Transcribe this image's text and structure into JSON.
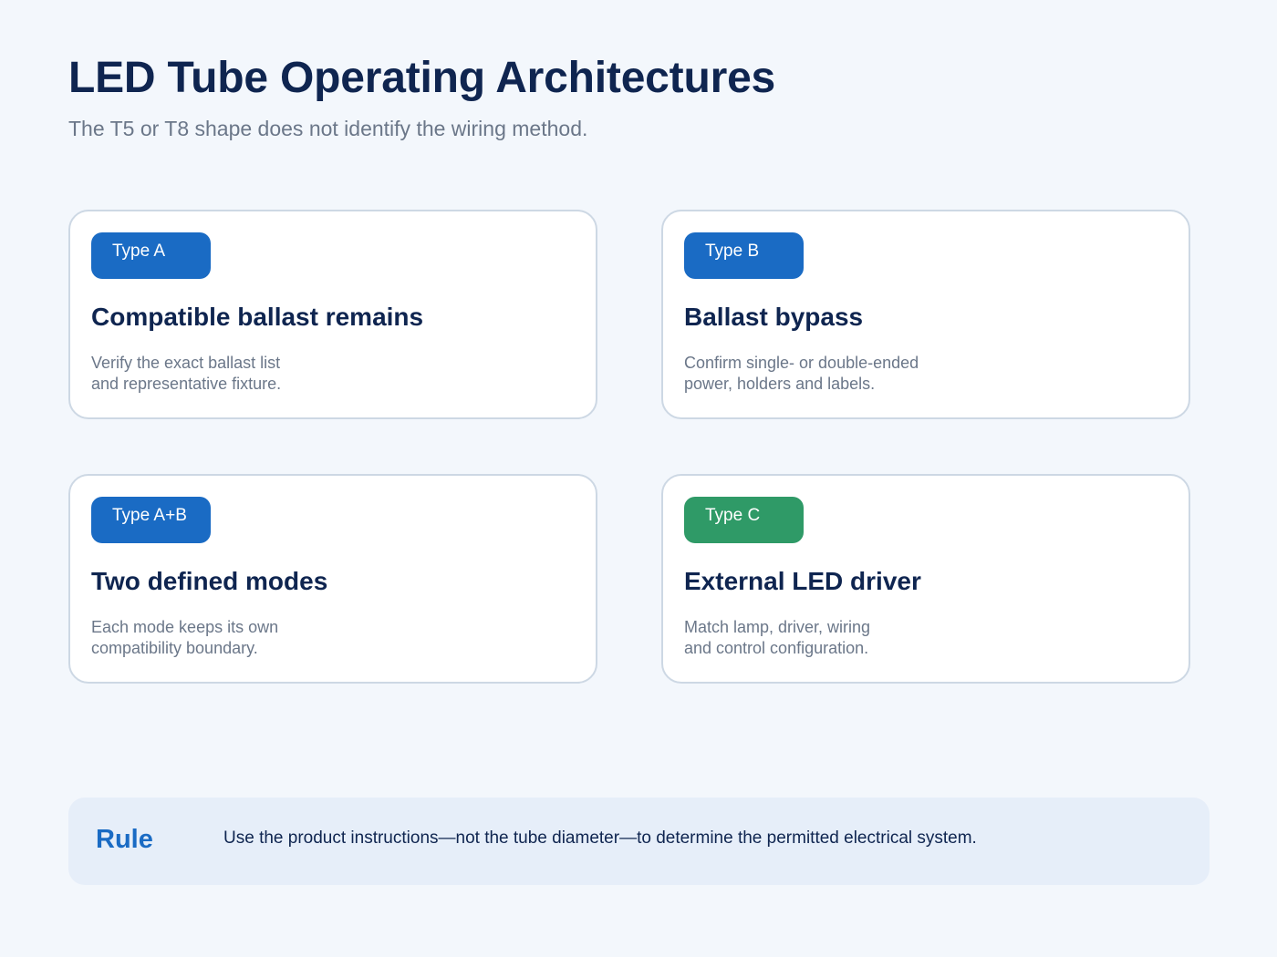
{
  "header": {
    "title": "LED Tube Operating Architectures",
    "subtitle": "The T5 or T8 shape does not identify the wiring method."
  },
  "colors": {
    "badge_blue": "#1a6bc4",
    "badge_green": "#2f9a67",
    "title_navy": "#0f2550",
    "muted_text": "#6b7789",
    "card_border": "#cdd8e4",
    "rule_bg": "#e6eef9"
  },
  "cards": [
    {
      "badge": "Type A",
      "badge_color": "#1a6bc4",
      "title": "Compatible ballast remains",
      "desc_lines": [
        "Verify the exact ballast list",
        "and representative fixture."
      ]
    },
    {
      "badge": "Type B",
      "badge_color": "#1a6bc4",
      "title": "Ballast bypass",
      "desc_lines": [
        "Confirm single- or double-ended",
        "power, holders and labels."
      ]
    },
    {
      "badge": "Type A+B",
      "badge_color": "#1a6bc4",
      "title": "Two defined modes",
      "desc_lines": [
        "Each mode keeps its own",
        "compatibility boundary."
      ]
    },
    {
      "badge": "Type C",
      "badge_color": "#2f9a67",
      "title": "External LED driver",
      "desc_lines": [
        "Match lamp, driver, wiring",
        "and control configuration."
      ]
    }
  ],
  "rule": {
    "label": "Rule",
    "text": "Use the product instructions—not the tube diameter—to determine the permitted electrical system."
  }
}
